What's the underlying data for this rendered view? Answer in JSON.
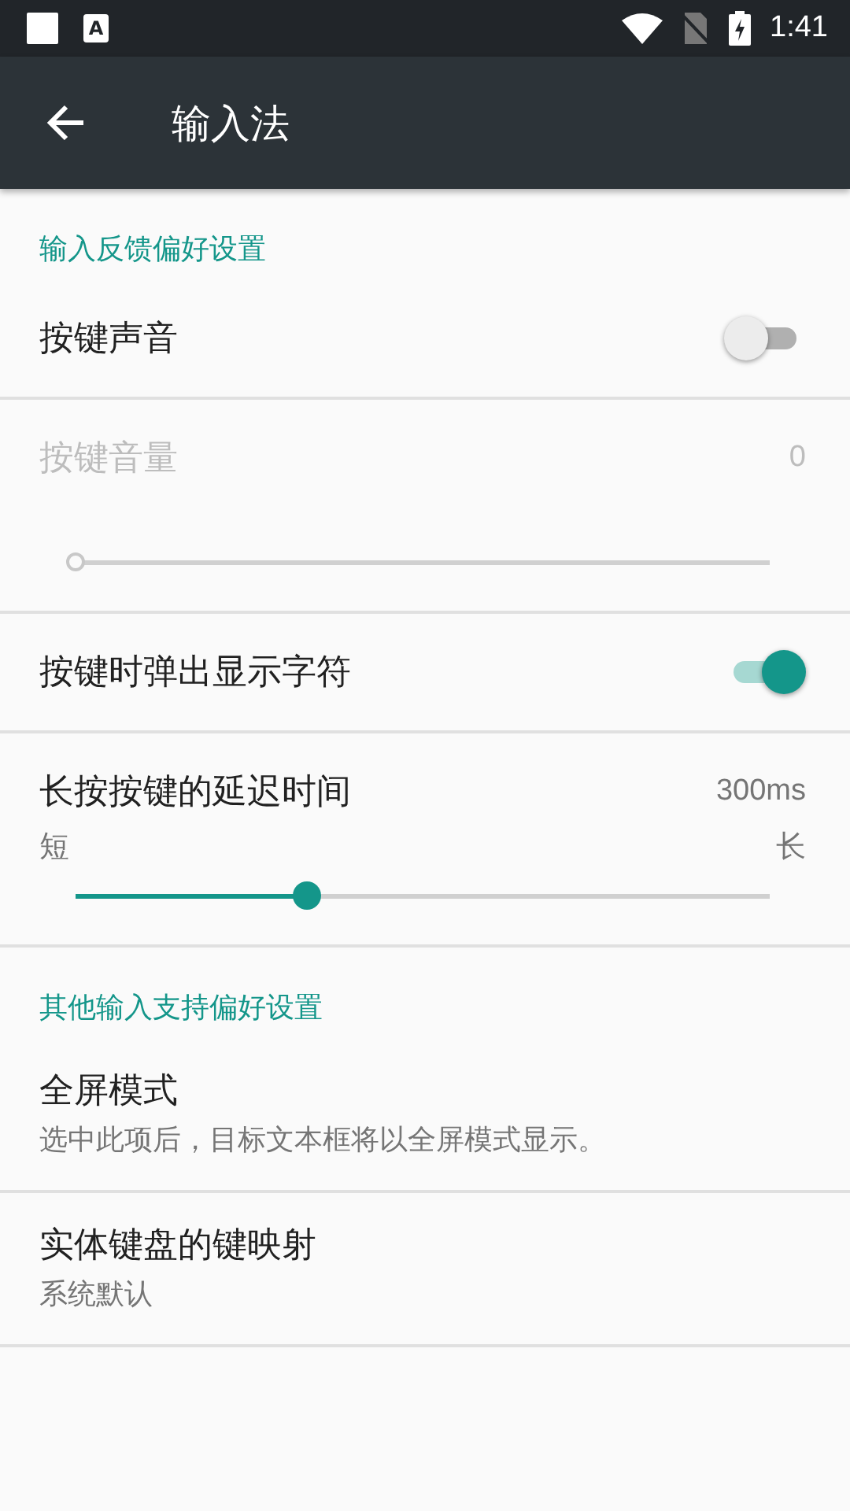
{
  "status_bar": {
    "notification_glyph": "A",
    "time": "1:41"
  },
  "app_bar": {
    "title": "输入法"
  },
  "items": [
    {
      "kind": "category",
      "title": "输入反馈偏好设置"
    },
    {
      "kind": "switch",
      "title": "按键声音",
      "on": false
    },
    {
      "kind": "slider",
      "title": "按键音量",
      "value": "0",
      "level": 0,
      "disabled": true
    },
    {
      "kind": "switch",
      "title": "按键时弹出显示字符",
      "on": true
    },
    {
      "kind": "slider",
      "title": "长按按键的延迟时间",
      "value": "300ms",
      "min_label": "短",
      "max_label": "长",
      "level": 0.334,
      "disabled": false
    },
    {
      "kind": "category",
      "title": "其他输入支持偏好设置"
    },
    {
      "kind": "text",
      "title": "全屏模式",
      "summary": "选中此项后，目标文本框将以全屏模式显示。"
    },
    {
      "kind": "text",
      "title": "实体键盘的键映射",
      "summary": "系统默认"
    }
  ]
}
